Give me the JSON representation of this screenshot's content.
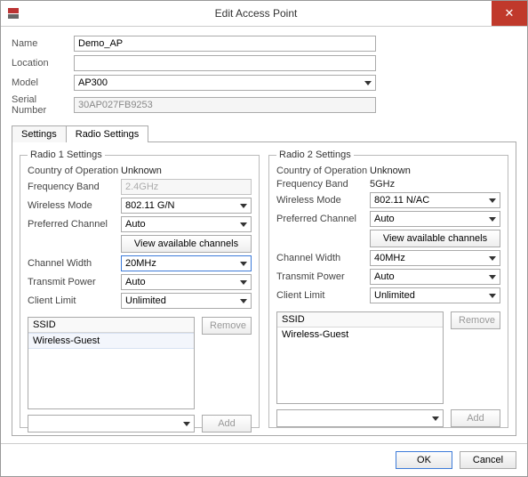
{
  "window": {
    "title": "Edit Access Point",
    "close_glyph": "✕"
  },
  "form": {
    "name_label": "Name",
    "name_value": "Demo_AP",
    "location_label": "Location",
    "location_value": "",
    "model_label": "Model",
    "model_value": "AP300",
    "serial_label": "Serial Number",
    "serial_value": "30AP027FB9253"
  },
  "tabs": {
    "settings": "Settings",
    "radio_settings": "Radio Settings"
  },
  "radio1": {
    "legend": "Radio 1 Settings",
    "country_label": "Country of Operation",
    "country_value": "Unknown",
    "freq_label": "Frequency Band",
    "freq_value": "2.4GHz",
    "mode_label": "Wireless Mode",
    "mode_value": "802.11 G/N",
    "channel_label": "Preferred Channel",
    "channel_value": "Auto",
    "view_channels": "View available channels",
    "width_label": "Channel Width",
    "width_value": "20MHz",
    "power_label": "Transmit Power",
    "power_value": "Auto",
    "limit_label": "Client Limit",
    "limit_value": "Unlimited",
    "ssid_header": "SSID",
    "ssid_items": [
      "Wireless-Guest"
    ],
    "remove": "Remove",
    "add": "Add",
    "add_select": ""
  },
  "radio2": {
    "legend": "Radio 2 Settings",
    "country_label": "Country of Operation",
    "country_value": "Unknown",
    "freq_label": "Frequency Band",
    "freq_value": "5GHz",
    "mode_label": "Wireless Mode",
    "mode_value": "802.11 N/AC",
    "channel_label": "Preferred Channel",
    "channel_value": "Auto",
    "view_channels": "View available channels",
    "width_label": "Channel Width",
    "width_value": "40MHz",
    "power_label": "Transmit Power",
    "power_value": "Auto",
    "limit_label": "Client Limit",
    "limit_value": "Unlimited",
    "ssid_header": "SSID",
    "ssid_items": [
      "Wireless-Guest"
    ],
    "remove": "Remove",
    "add": "Add",
    "add_select": ""
  },
  "footer": {
    "ok": "OK",
    "cancel": "Cancel"
  }
}
